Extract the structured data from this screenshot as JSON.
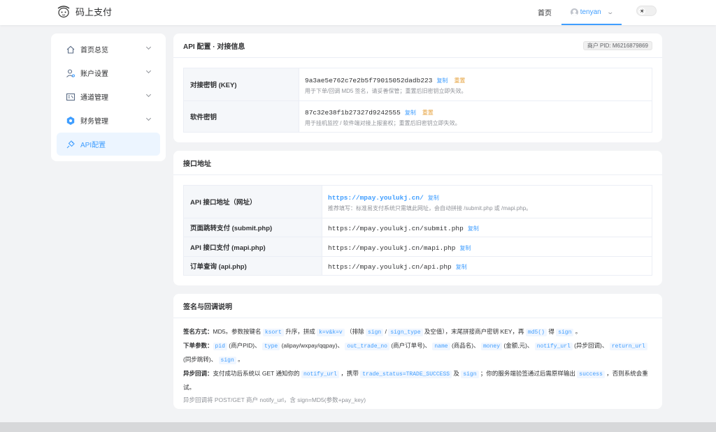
{
  "header": {
    "brand_name": "码上支付",
    "nav_home": "首页",
    "username": "tenyan",
    "user_chevron": "⌄",
    "theme_icon": "sun-icon"
  },
  "sidebar": {
    "items": [
      {
        "label": "首页总览",
        "icon": "home-icon"
      },
      {
        "label": "账户设置",
        "icon": "user-icon"
      },
      {
        "label": "通道管理",
        "icon": "channel-icon"
      },
      {
        "label": "财务管理",
        "icon": "finance-icon"
      },
      {
        "label": "API配置",
        "icon": "api-icon"
      }
    ]
  },
  "api_config": {
    "title": "API 配置 · 对接信息",
    "pid_badge": "商户 PID: M6216879869",
    "rows": [
      {
        "label": "对接密钥 (KEY)",
        "value": "9a3ae5e762c7e2b5f79015052dadb223",
        "copy": "复制",
        "reset": "重置",
        "hint": "用于下单/回调 MD5 签名，请妥善保管；重置后旧密钥立即失效。"
      },
      {
        "label": "软件密钥",
        "value": "87c32e38f1b27327d9242555",
        "copy": "复制",
        "reset": "重置",
        "hint": "用于挂机监控 / 软件端对接上报鉴权；重置后旧密钥立即失效。"
      }
    ]
  },
  "endpoints": {
    "title": "接口地址",
    "rows": [
      {
        "label": "API 接口地址（网址）",
        "value": "https://mpay.youlukj.cn/",
        "copy": "复制",
        "hint": "推荐填写：标准易支付系统只需填此网址，会自动拼接 /submit.php 或 /mapi.php。"
      },
      {
        "label": "页面跳转支付 (submit.php)",
        "value": "https://mpay.youlukj.cn/submit.php",
        "copy": "复制"
      },
      {
        "label": "API 接口支付 (mapi.php)",
        "value": "https://mpay.youlukj.cn/mapi.php",
        "copy": "复制"
      },
      {
        "label": "订单查询 (api.php)",
        "value": "https://mpay.youlukj.cn/api.php",
        "copy": "复制"
      }
    ]
  },
  "sign": {
    "title": "签名与回调说明",
    "l1": {
      "label": "签名方式：",
      "t1": "MD5。参数按键名",
      "c1": "ksort",
      "t2": "升序，拼成",
      "c2": "k=v&k=v",
      "t3": "（排除",
      "c3": "sign",
      "t4": "/",
      "c4": "sign_type",
      "t5": "及空值），末尾拼接商户密钥 KEY，再",
      "c5": "md5()",
      "t6": "得",
      "c6": "sign",
      "t7": "。"
    },
    "l2": {
      "label": "下单参数：",
      "c1": "pid",
      "t1": "(商户PID)、",
      "c2": "type",
      "t2": "(alipay/wxpay/qqpay)、",
      "c3": "out_trade_no",
      "t3": "(商户订单号)、",
      "c4": "name",
      "t4": "(商品名)、",
      "c5": "money",
      "t5": "(金额,元)、",
      "c6": "notify_url",
      "t6": "(异步回调)、",
      "c7": "return_url",
      "t7": "(同步跳转)、",
      "c8": "sign",
      "t8": "。"
    },
    "l3": {
      "label": "异步回调：",
      "t1": "支付成功后系统以 GET 通知你的",
      "c1": "notify_url",
      "t2": "，携带",
      "c2": "trade_status=TRADE_SUCCESS",
      "t3": "及",
      "c3": "sign",
      "t4": "；你的服务端验签通过后需原样输出",
      "c4": "success",
      "t5": "，否则系统会重试。"
    },
    "l4": "异步回调将 POST/GET 商户 notify_url，含 sign=MD5(参数+pay_key)"
  },
  "colors": {
    "accent": "#409eff",
    "warn": "#e6a23c",
    "background": "#f2f3f5"
  }
}
